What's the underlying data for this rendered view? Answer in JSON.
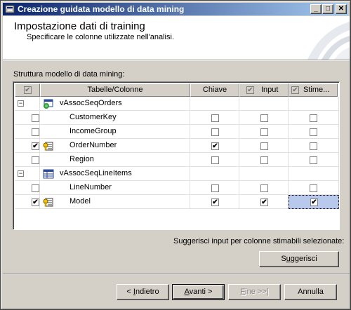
{
  "window": {
    "title": "Creazione guidata modello di data mining",
    "min_glyph": "_",
    "max_glyph": "□",
    "close_glyph": "✕"
  },
  "header": {
    "title": "Impostazione dati di training",
    "subtitle": "Specificare le colonne utilizzate nell'analisi."
  },
  "structure_label": "Struttura modello di data mining:",
  "grid": {
    "columns": {
      "tables": "Tabelle/Colonne",
      "key": "Chiave",
      "input": "Input",
      "predict": "Stime..."
    },
    "header_checks": {
      "select": true,
      "input": true,
      "predict": true
    },
    "rows": [
      {
        "type": "table",
        "name": "vAssocSeqOrders",
        "expanded": true,
        "icon": "table-icon"
      },
      {
        "type": "column",
        "name": "CustomerKey",
        "selected": false,
        "key_icon": false,
        "key": false,
        "input": false,
        "predict": false
      },
      {
        "type": "column",
        "name": "IncomeGroup",
        "selected": false,
        "key_icon": false,
        "key": false,
        "input": false,
        "predict": false
      },
      {
        "type": "column",
        "name": "OrderNumber",
        "selected": true,
        "key_icon": true,
        "key": true,
        "input": false,
        "predict": false
      },
      {
        "type": "column",
        "name": "Region",
        "selected": false,
        "key_icon": false,
        "key": false,
        "input": false,
        "predict": false
      },
      {
        "type": "table",
        "name": "vAssocSeqLineItems",
        "expanded": true,
        "icon": "nested-table-icon"
      },
      {
        "type": "column",
        "name": "LineNumber",
        "selected": false,
        "key_icon": false,
        "key": false,
        "input": false,
        "predict": false
      },
      {
        "type": "column",
        "name": "Model",
        "selected": true,
        "key_icon": true,
        "key": true,
        "input": true,
        "predict": true,
        "focused_predict": true
      }
    ]
  },
  "suggest": {
    "label": "Suggerisci input per colonne stimabili selezionate:",
    "button_pre": "S",
    "button_mn": "u",
    "button_post": "ggerisci"
  },
  "buttons": {
    "back": {
      "pre": "< ",
      "mn": "I",
      "post": "ndietro"
    },
    "next": {
      "pre": "",
      "mn": "A",
      "post": "vanti >"
    },
    "finish": {
      "pre": "",
      "mn": "F",
      "post": "ine >>|"
    },
    "cancel": "Annulla"
  },
  "check_glyph": "✔",
  "tree_minus": "−"
}
